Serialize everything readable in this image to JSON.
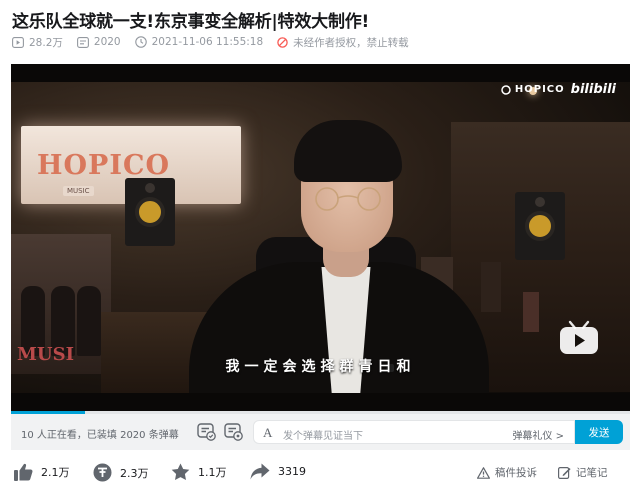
{
  "video": {
    "title": "这乐队全球就一支!东京事变全解析|特效大制作!",
    "views": "28.2万",
    "danmaku_count": "2020",
    "publish_time": "2021-11-06 11:55:18",
    "copyright_notice": "未经作者授权，禁止转载"
  },
  "player": {
    "brand": "HOPICO",
    "platform": "bilibili",
    "subtitle": "我一定会选择群青日和",
    "scene_sign": "HOPICO",
    "scene_sign_sub": "MUSIC",
    "scene_poster_text": "MUSI",
    "progress": 0.12,
    "accent_color": "#00a1d6"
  },
  "danmaku_bar": {
    "watching_text": "10 人正在看，已装填 2020 条弹幕",
    "input_placeholder": "发个弹幕见证当下",
    "etiquette_label": "弹幕礼仪 >",
    "send_label": "发送",
    "toggle_icons": [
      "danmaku-toggle-icon",
      "danmaku-settings-icon"
    ]
  },
  "actions": {
    "like_count": "2.1万",
    "coin_count": "2.3万",
    "favorite_count": "1.1万",
    "share_count": "3319",
    "report_label": "稿件投诉",
    "notes_label": "记笔记"
  }
}
